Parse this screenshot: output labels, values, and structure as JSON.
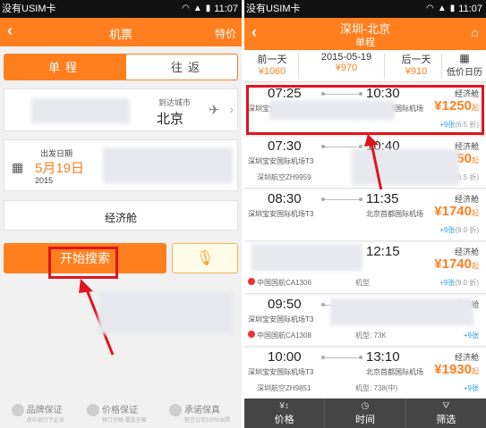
{
  "left": {
    "status": {
      "carrier": "没有USIM卡",
      "time": "11:07"
    },
    "nav": {
      "back": "‹",
      "title": "机票",
      "right": "特价"
    },
    "tabs": {
      "oneway": "单程",
      "roundtrip": "往返"
    },
    "city": {
      "dest_label": "到达城市",
      "dest_city": "北京"
    },
    "date": {
      "label": "出发日期",
      "value": "5月19日",
      "year": "2015"
    },
    "cabin": "经济舱",
    "search": "开始搜索",
    "footer": [
      {
        "title": "品牌保证",
        "sub": "途中旅行下企业"
      },
      {
        "title": "价格保证",
        "sub": "预订价格 覆盖全国"
      },
      {
        "title": "承诺保真",
        "sub": "航空公司100%出票"
      }
    ]
  },
  "right": {
    "status": {
      "carrier": "没有USIM卡",
      "time": "11:07"
    },
    "nav": {
      "route": "深圳-北京",
      "type": "单程"
    },
    "datebar": {
      "prev": {
        "label": "前一天",
        "price": "¥1060"
      },
      "current": {
        "label": "2015-05-19",
        "price": "¥970"
      },
      "next": {
        "label": "后一天",
        "price": "¥910"
      },
      "calendar": "低价日历"
    },
    "flights": [
      {
        "dep": "07:25",
        "arr": "10:30",
        "dep_airport": "深圳宝安国际机场T3",
        "arr_airport": "北京首都国际机场",
        "cabin": "经济舱",
        "price": "¥1250",
        "seats": "+9张",
        "discount": "(6.5 折)",
        "airline": "",
        "model": ""
      },
      {
        "dep": "07:30",
        "arr": "10:40",
        "dep_airport": "深圳宝安国际机场T3",
        "arr_airport": "",
        "cabin": "经济舱",
        "price": "¥1250",
        "seats": "",
        "discount": "(6.5 折)",
        "airline": "深圳航空ZH9959",
        "model": "机型"
      },
      {
        "dep": "08:30",
        "arr": "11:35",
        "dep_airport": "深圳宝安国际机场T3",
        "arr_airport": "北京首都国际机场",
        "cabin": "经济舱",
        "price": "¥1740",
        "seats": "+9张",
        "discount": "(9.0 折)",
        "airline": "",
        "model": ""
      },
      {
        "dep": "",
        "arr": "12:15",
        "dep_airport": "",
        "arr_airport": "",
        "cabin": "经济舱",
        "price": "¥1740",
        "seats": "+9张",
        "discount": "(9.0 折)",
        "airline": "中国国航CA1306",
        "model": "机型"
      },
      {
        "dep": "09:50",
        "arr": "",
        "dep_airport": "深圳宝安国际机场T3",
        "arr_airport": "",
        "cabin": "经济舱",
        "price": "",
        "seats": "+9张",
        "discount": "",
        "airline": "中国国航CA1308",
        "model": "机型: 73K"
      },
      {
        "dep": "10:00",
        "arr": "13:10",
        "dep_airport": "深圳宝安国际机场T3",
        "arr_airport": "北京首都国际机场",
        "cabin": "经济舱",
        "price": "¥1930",
        "seats": "+9张",
        "discount": "",
        "airline": "深圳航空ZH9851",
        "model": "机型: 738(中)"
      }
    ],
    "bottom": [
      {
        "label": "价格",
        "icon": "¥↕"
      },
      {
        "label": "时间",
        "icon": "◷"
      },
      {
        "label": "筛选",
        "icon": "⛛"
      }
    ]
  }
}
